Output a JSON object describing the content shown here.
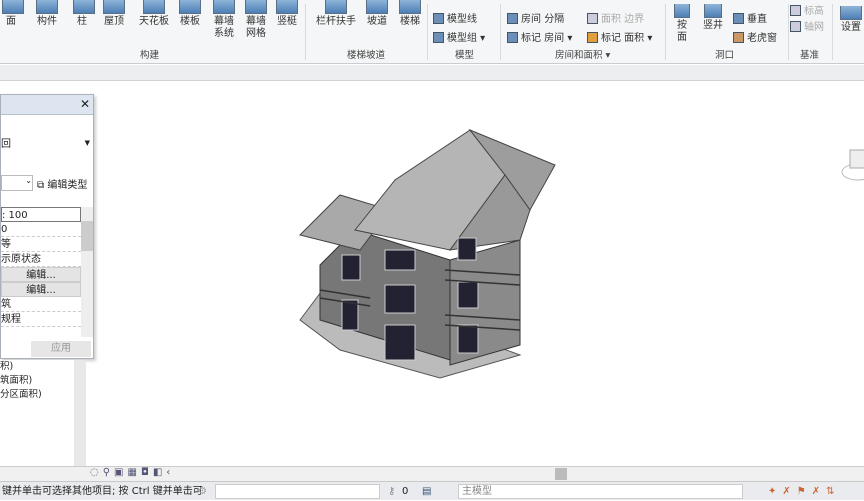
{
  "ribbon": {
    "tools": [
      {
        "label": "面",
        "l2": ""
      },
      {
        "label": "构件",
        "l2": ""
      },
      {
        "label": "柱",
        "l2": ""
      },
      {
        "label": "屋顶",
        "l2": ""
      },
      {
        "label": "天花板",
        "l2": ""
      },
      {
        "label": "楼板",
        "l2": ""
      },
      {
        "label": "幕墙",
        "l2": "系统"
      },
      {
        "label": "幕墙",
        "l2": "网格"
      },
      {
        "label": "竖梃",
        "l2": ""
      },
      {
        "label": "栏杆扶手",
        "l2": ""
      },
      {
        "label": "坡道",
        "l2": ""
      },
      {
        "label": "楼梯",
        "l2": ""
      }
    ],
    "model": {
      "line": "模型线",
      "group": "模型组"
    },
    "room": {
      "room": "房间",
      "sep": "分隔",
      "area_boundary": "面积 边界",
      "tag_room": "标记 房间",
      "tag_area": "标记 面积"
    },
    "opening": {
      "by_face": "按",
      "by_face2": "面",
      "shaft": "竖井",
      "vertical": "垂直",
      "dormer": "老虎窗"
    },
    "datum": {
      "level": "标高",
      "grid": "轴网"
    },
    "set": "设置",
    "panels": {
      "build": "构建",
      "stairs": "楼梯坡道",
      "model": "模型",
      "room": "房间和面积 ▾",
      "opening": "洞口",
      "datum": "基准"
    }
  },
  "properties": {
    "type_selector": "",
    "edit_type": "编辑类型",
    "rows": [
      ": 100",
      "0",
      "等",
      "示原状态",
      "编辑...",
      "编辑...",
      "筑",
      "规程"
    ],
    "apply": "应用"
  },
  "browser": {
    "items": [
      "积)",
      "筑面积)",
      "分区面积)"
    ]
  },
  "status": {
    "hint": "键并单击可选择其他项目; 按 Ctrl 键并单击可",
    "count": "0",
    "model": "主模型"
  }
}
